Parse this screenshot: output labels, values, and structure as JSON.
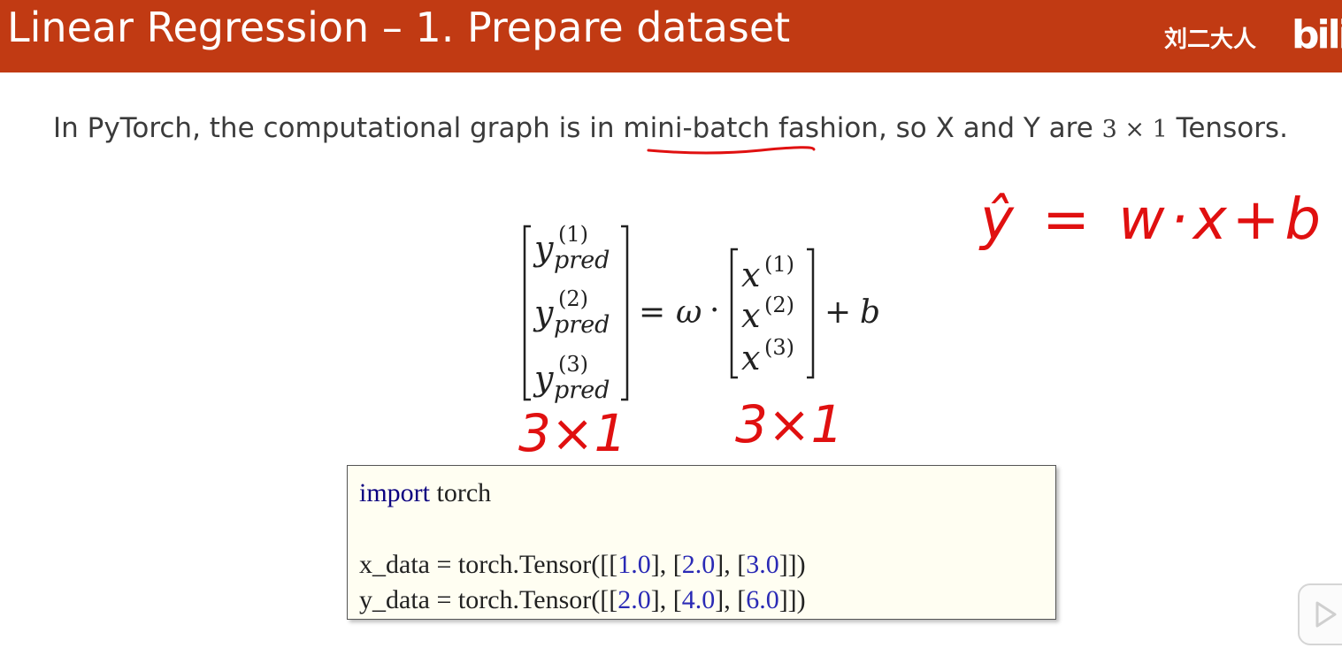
{
  "slide": {
    "title": "Linear Regression – 1. Prepare dataset",
    "watermark_author": "刘二大人",
    "watermark_site": "bili",
    "accent_color": "#c13a13",
    "sentence": {
      "part1": "In PyTorch, the computational graph is in ",
      "highlight": "mini-batch",
      "part2": " fashion, so X and Y are ",
      "math": "3 × 1",
      "part3": " Tensors."
    }
  },
  "equation": {
    "lhs_entries": [
      {
        "var": "y",
        "sup": "(1)",
        "sub": "pred"
      },
      {
        "var": "y",
        "sup": "(2)",
        "sub": "pred"
      },
      {
        "var": "y",
        "sup": "(3)",
        "sub": "pred"
      }
    ],
    "equals": "=",
    "weight": "ω",
    "dot": "·",
    "rhs_entries": [
      {
        "var": "x",
        "sup": "(1)"
      },
      {
        "var": "x",
        "sup": "(2)"
      },
      {
        "var": "x",
        "sup": "(3)"
      }
    ],
    "plus": "+",
    "bias": "b"
  },
  "annotations": {
    "ink_color": "#e01010",
    "handwritten_formula": "ŷ = w·x+b",
    "lhs_shape": "3×1",
    "rhs_shape": "3×1"
  },
  "code": {
    "line1_kw": "import",
    "line1_rest": " torch",
    "line3_prefix": "x_data = torch.Tensor([[",
    "line3_v1": "1.0",
    "line3_mid1": "], [",
    "line3_v2": "2.0",
    "line3_mid2": "], [",
    "line3_v3": "3.0",
    "line3_end": "]])",
    "line4_prefix": "y_data = torch.Tensor([[",
    "line4_v1": "2.0",
    "line4_mid1": "], [",
    "line4_v2": "4.0",
    "line4_mid2": "], [",
    "line4_v3": "6.0",
    "line4_end": "]])"
  },
  "player": {
    "play_icon": "play-icon"
  }
}
